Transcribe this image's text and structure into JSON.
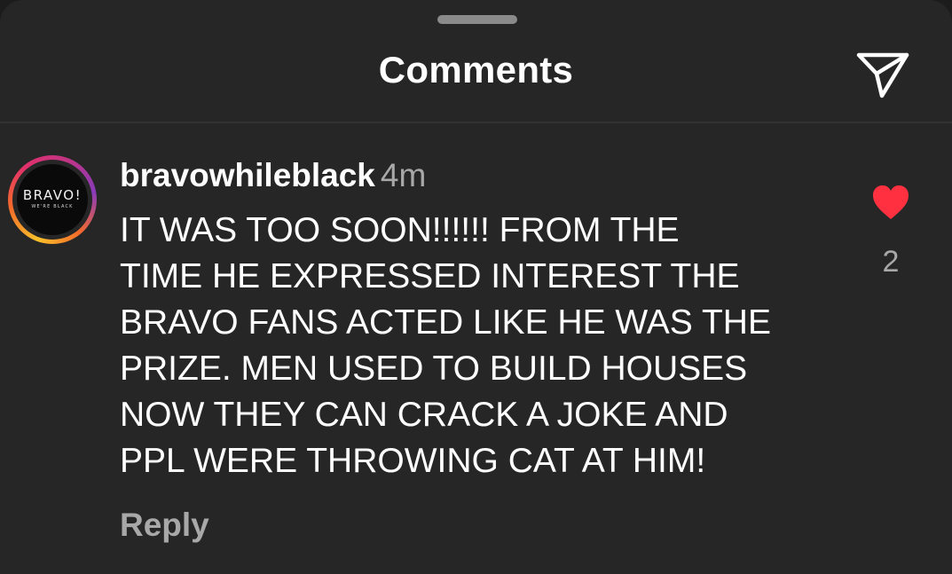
{
  "sheet": {
    "title": "Comments",
    "icons": {
      "grabber": "drag-handle",
      "share": "paper-plane-icon"
    }
  },
  "comment": {
    "avatar": {
      "logo_text": "BRAVO!",
      "logo_subtext": "WE'RE BLACK"
    },
    "username": "bravowhileblack",
    "time": "4m",
    "text": "IT WAS TOO SOON!!!!!! FROM THE\nTIME HE EXPRESSED INTEREST THE\nBRAVO FANS ACTED LIKE HE WAS THE\nPRIZE. MEN USED TO BUILD HOUSES\nNOW THEY CAN CRACK A JOKE AND\nPPL WERE THROWING CAT AT HIM!",
    "reply_label": "Reply",
    "likes": "2",
    "liked": true,
    "icons": {
      "like": "heart-icon"
    }
  },
  "colors": {
    "background": "#262626",
    "text": "#ffffff",
    "secondary_text": "#a8a8a8",
    "heart": "#ff3040"
  }
}
